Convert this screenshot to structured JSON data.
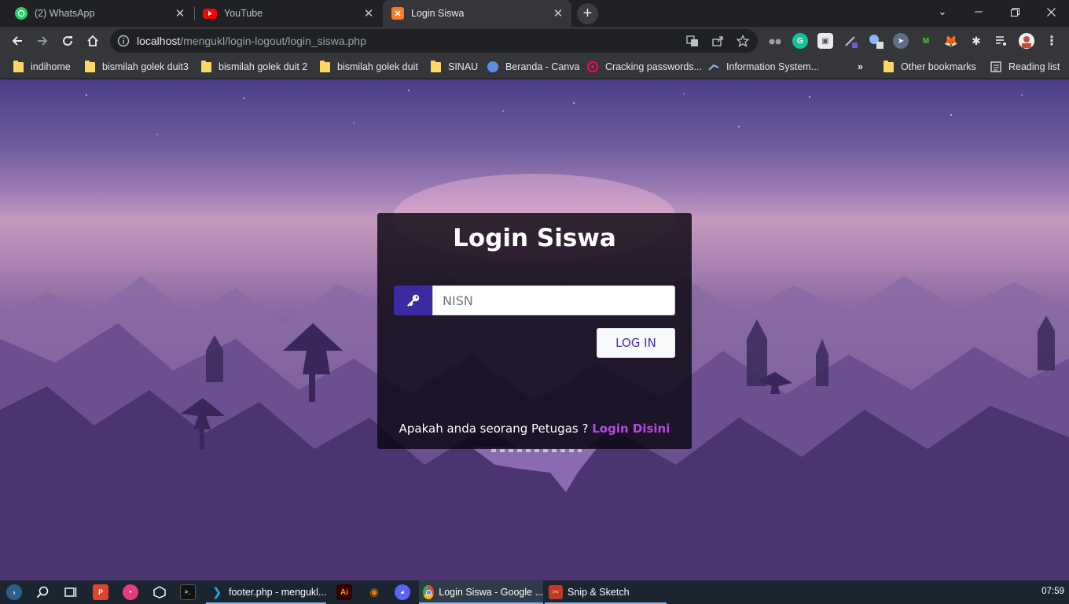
{
  "browser": {
    "tabs": [
      {
        "title": "(2) WhatsApp",
        "icon": "whatsapp-icon",
        "active": false
      },
      {
        "title": "YouTube",
        "icon": "youtube-icon",
        "active": false
      },
      {
        "title": "Login Siswa",
        "icon": "xampp-icon",
        "active": true
      }
    ],
    "address": {
      "host": "localhost",
      "path": "/mengukl/login-logout/login_siswa.php"
    },
    "bookmarks": [
      {
        "label": "indihome",
        "icon": "folder-icon"
      },
      {
        "label": "bismilah golek duit3",
        "icon": "folder-icon"
      },
      {
        "label": "bismilah golek duit 2",
        "icon": "folder-icon"
      },
      {
        "label": "bismilah golek duit",
        "icon": "folder-icon"
      },
      {
        "label": "SINAU",
        "icon": "folder-icon"
      },
      {
        "label": "Beranda - Canva",
        "icon": "canva-icon"
      },
      {
        "label": "Cracking passwords...",
        "icon": "target-icon"
      },
      {
        "label": "Information System...",
        "icon": "page-icon"
      }
    ],
    "bookmarks_overflow": "»",
    "other_bookmarks": "Other bookmarks",
    "reading_list": "Reading list"
  },
  "login": {
    "title": "Login Siswa",
    "nisn_placeholder": "NISN",
    "login_button": "LOG IN",
    "footer_text": "Apakah anda seorang Petugas ?",
    "footer_link": "Login Disini"
  },
  "taskbar": {
    "items": [
      {
        "label": "footer.php - mengukl...",
        "icon": "vscode-icon"
      },
      {
        "label": "Login Siswa - Google ...",
        "icon": "chrome-icon",
        "active": true
      },
      {
        "label": "Snip & Sketch",
        "icon": "snip-sketch-icon"
      }
    ],
    "clock": "07:59"
  },
  "colors": {
    "accent": "#3c2aa3",
    "link": "#b548e8",
    "button_text": "#4b2bb0"
  }
}
